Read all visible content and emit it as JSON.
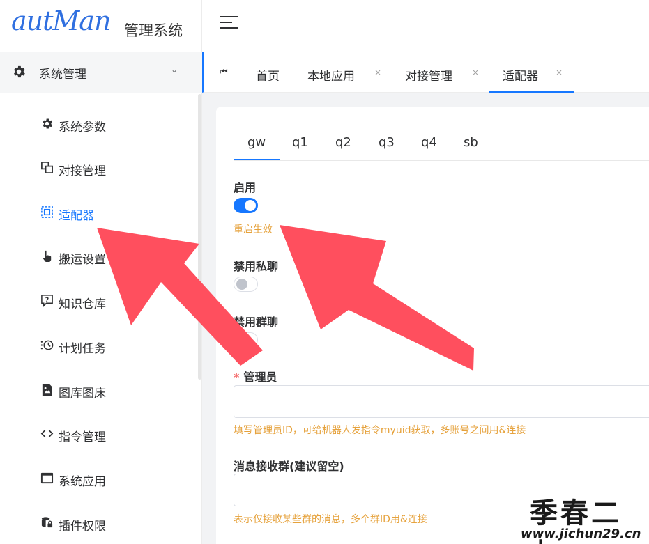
{
  "app": {
    "logo_script": "autMan",
    "logo_text": "管理系统"
  },
  "sidebar": {
    "group": {
      "label": "系统管理",
      "icon": "gear-icon",
      "expanded": true
    },
    "items": [
      {
        "label": "系统参数",
        "icon": "gear-icon"
      },
      {
        "label": "对接管理",
        "icon": "copy-icon"
      },
      {
        "label": "适配器",
        "icon": "adapter-icon",
        "active": true
      },
      {
        "label": "搬运设置",
        "icon": "hand-pointer-icon"
      },
      {
        "label": "知识仓库",
        "icon": "question-chat-icon"
      },
      {
        "label": "计划任务",
        "icon": "schedule-icon"
      },
      {
        "label": "图库图床",
        "icon": "image-file-icon"
      },
      {
        "label": "指令管理",
        "icon": "code-icon"
      },
      {
        "label": "系统应用",
        "icon": "window-icon"
      },
      {
        "label": "插件权限",
        "icon": "database-lock-icon"
      }
    ]
  },
  "tabs": [
    {
      "label": "首页",
      "closable": false
    },
    {
      "label": "本地应用",
      "closable": true
    },
    {
      "label": "对接管理",
      "closable": true
    },
    {
      "label": "适配器",
      "closable": true,
      "active": true
    }
  ],
  "tab_close_glyph": "×",
  "subtabs": [
    "gw",
    "q1",
    "q2",
    "q3",
    "q4",
    "sb"
  ],
  "form": {
    "enable": {
      "label": "启用",
      "value": true,
      "hint": "重启生效"
    },
    "disable_private": {
      "label": "禁用私聊",
      "value": false
    },
    "disable_group": {
      "label": "禁用群聊",
      "value": false
    },
    "admin": {
      "label": "管理员",
      "required_mark": "*",
      "value": "",
      "hint": "填写管理员ID，可给机器人发指令myuid获取，多账号之间用&连接"
    },
    "msg_group": {
      "label": "消息接收群(建议留空)",
      "value": "",
      "hint": "表示仅接收某些群的消息，多个群ID用&连接"
    }
  },
  "colors": {
    "accent": "#1677ff",
    "hint": "#e6a23c",
    "arrow": "#ff4f5e"
  },
  "watermark": {
    "big": "季春二九",
    "small": "www.jichun29.cn"
  }
}
